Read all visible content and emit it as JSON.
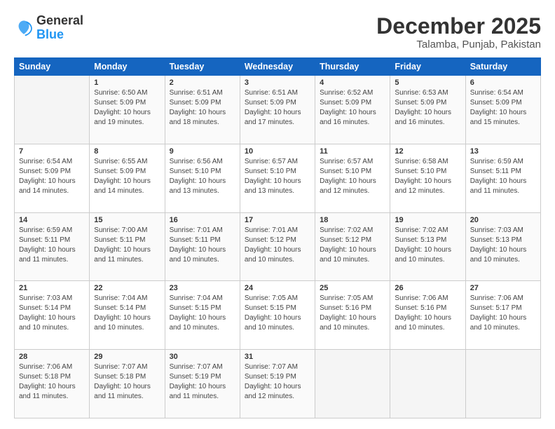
{
  "logo": {
    "line1": "General",
    "line2": "Blue"
  },
  "title": "December 2025",
  "subtitle": "Talamba, Punjab, Pakistan",
  "headers": [
    "Sunday",
    "Monday",
    "Tuesday",
    "Wednesday",
    "Thursday",
    "Friday",
    "Saturday"
  ],
  "weeks": [
    [
      {
        "day": "",
        "info": ""
      },
      {
        "day": "1",
        "info": "Sunrise: 6:50 AM\nSunset: 5:09 PM\nDaylight: 10 hours\nand 19 minutes."
      },
      {
        "day": "2",
        "info": "Sunrise: 6:51 AM\nSunset: 5:09 PM\nDaylight: 10 hours\nand 18 minutes."
      },
      {
        "day": "3",
        "info": "Sunrise: 6:51 AM\nSunset: 5:09 PM\nDaylight: 10 hours\nand 17 minutes."
      },
      {
        "day": "4",
        "info": "Sunrise: 6:52 AM\nSunset: 5:09 PM\nDaylight: 10 hours\nand 16 minutes."
      },
      {
        "day": "5",
        "info": "Sunrise: 6:53 AM\nSunset: 5:09 PM\nDaylight: 10 hours\nand 16 minutes."
      },
      {
        "day": "6",
        "info": "Sunrise: 6:54 AM\nSunset: 5:09 PM\nDaylight: 10 hours\nand 15 minutes."
      }
    ],
    [
      {
        "day": "7",
        "info": "Sunrise: 6:54 AM\nSunset: 5:09 PM\nDaylight: 10 hours\nand 14 minutes."
      },
      {
        "day": "8",
        "info": "Sunrise: 6:55 AM\nSunset: 5:09 PM\nDaylight: 10 hours\nand 14 minutes."
      },
      {
        "day": "9",
        "info": "Sunrise: 6:56 AM\nSunset: 5:10 PM\nDaylight: 10 hours\nand 13 minutes."
      },
      {
        "day": "10",
        "info": "Sunrise: 6:57 AM\nSunset: 5:10 PM\nDaylight: 10 hours\nand 13 minutes."
      },
      {
        "day": "11",
        "info": "Sunrise: 6:57 AM\nSunset: 5:10 PM\nDaylight: 10 hours\nand 12 minutes."
      },
      {
        "day": "12",
        "info": "Sunrise: 6:58 AM\nSunset: 5:10 PM\nDaylight: 10 hours\nand 12 minutes."
      },
      {
        "day": "13",
        "info": "Sunrise: 6:59 AM\nSunset: 5:11 PM\nDaylight: 10 hours\nand 11 minutes."
      }
    ],
    [
      {
        "day": "14",
        "info": "Sunrise: 6:59 AM\nSunset: 5:11 PM\nDaylight: 10 hours\nand 11 minutes."
      },
      {
        "day": "15",
        "info": "Sunrise: 7:00 AM\nSunset: 5:11 PM\nDaylight: 10 hours\nand 11 minutes."
      },
      {
        "day": "16",
        "info": "Sunrise: 7:01 AM\nSunset: 5:11 PM\nDaylight: 10 hours\nand 10 minutes."
      },
      {
        "day": "17",
        "info": "Sunrise: 7:01 AM\nSunset: 5:12 PM\nDaylight: 10 hours\nand 10 minutes."
      },
      {
        "day": "18",
        "info": "Sunrise: 7:02 AM\nSunset: 5:12 PM\nDaylight: 10 hours\nand 10 minutes."
      },
      {
        "day": "19",
        "info": "Sunrise: 7:02 AM\nSunset: 5:13 PM\nDaylight: 10 hours\nand 10 minutes."
      },
      {
        "day": "20",
        "info": "Sunrise: 7:03 AM\nSunset: 5:13 PM\nDaylight: 10 hours\nand 10 minutes."
      }
    ],
    [
      {
        "day": "21",
        "info": "Sunrise: 7:03 AM\nSunset: 5:14 PM\nDaylight: 10 hours\nand 10 minutes."
      },
      {
        "day": "22",
        "info": "Sunrise: 7:04 AM\nSunset: 5:14 PM\nDaylight: 10 hours\nand 10 minutes."
      },
      {
        "day": "23",
        "info": "Sunrise: 7:04 AM\nSunset: 5:15 PM\nDaylight: 10 hours\nand 10 minutes."
      },
      {
        "day": "24",
        "info": "Sunrise: 7:05 AM\nSunset: 5:15 PM\nDaylight: 10 hours\nand 10 minutes."
      },
      {
        "day": "25",
        "info": "Sunrise: 7:05 AM\nSunset: 5:16 PM\nDaylight: 10 hours\nand 10 minutes."
      },
      {
        "day": "26",
        "info": "Sunrise: 7:06 AM\nSunset: 5:16 PM\nDaylight: 10 hours\nand 10 minutes."
      },
      {
        "day": "27",
        "info": "Sunrise: 7:06 AM\nSunset: 5:17 PM\nDaylight: 10 hours\nand 10 minutes."
      }
    ],
    [
      {
        "day": "28",
        "info": "Sunrise: 7:06 AM\nSunset: 5:18 PM\nDaylight: 10 hours\nand 11 minutes."
      },
      {
        "day": "29",
        "info": "Sunrise: 7:07 AM\nSunset: 5:18 PM\nDaylight: 10 hours\nand 11 minutes."
      },
      {
        "day": "30",
        "info": "Sunrise: 7:07 AM\nSunset: 5:19 PM\nDaylight: 10 hours\nand 11 minutes."
      },
      {
        "day": "31",
        "info": "Sunrise: 7:07 AM\nSunset: 5:19 PM\nDaylight: 10 hours\nand 12 minutes."
      },
      {
        "day": "",
        "info": ""
      },
      {
        "day": "",
        "info": ""
      },
      {
        "day": "",
        "info": ""
      }
    ]
  ]
}
